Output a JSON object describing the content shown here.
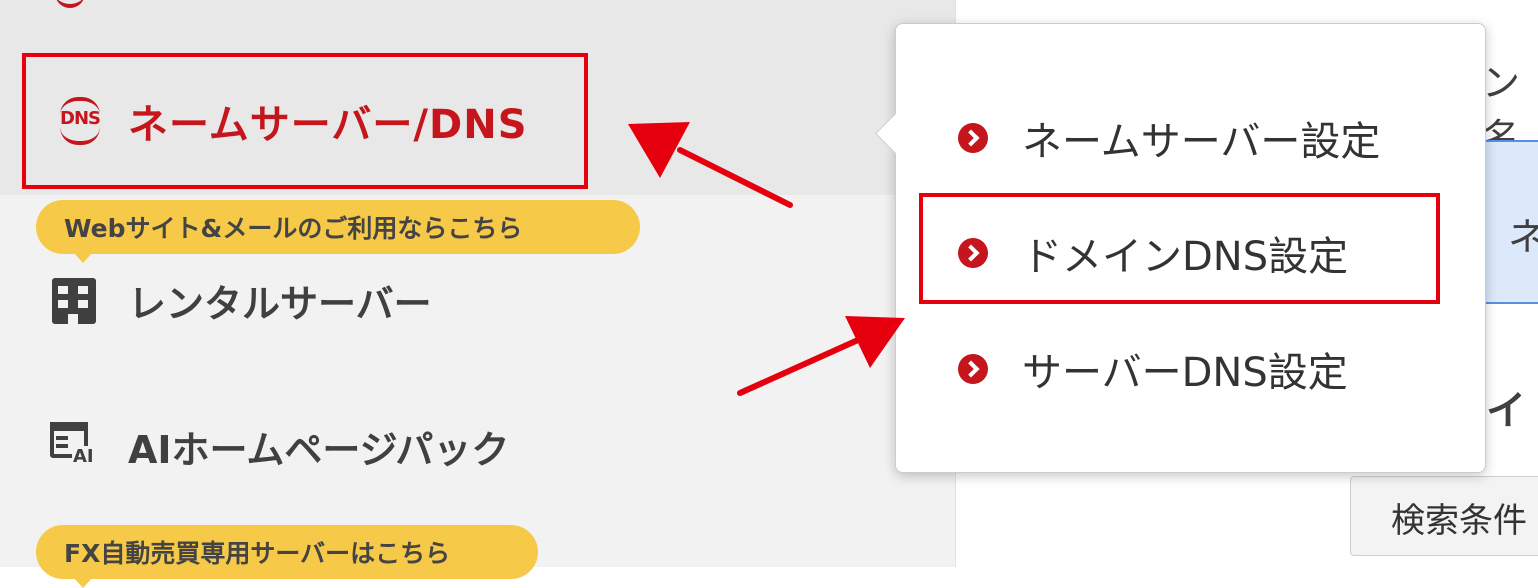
{
  "sidebar": {
    "active_item": {
      "icon": "dns-icon",
      "icon_text": "DNS",
      "label": "ネームサーバー/DNS"
    },
    "badge_web": "Webサイト&メールのご利用ならこちら",
    "rental": {
      "icon": "building-icon",
      "label": "レンタルサーバー"
    },
    "ai_pack": {
      "icon": "ai-homepage-icon",
      "icon_text": "AI",
      "label": "AIホームページパック"
    },
    "badge_fx": "FX自動売買専用サーバーはこちら"
  },
  "popup": {
    "items": [
      {
        "icon": "chevron-right-icon",
        "label": "ネームサーバー設定"
      },
      {
        "icon": "chevron-right-icon",
        "label": "ドメインDNS設定"
      },
      {
        "icon": "chevron-right-icon",
        "label": "サーバーDNS設定"
      }
    ]
  },
  "main": {
    "partial_1": "ン名",
    "partial_2": "ネ",
    "partial_3": "イ",
    "search_button_partial": "検索条件"
  },
  "colors": {
    "brand_red": "#c4161c",
    "highlight_red": "#e6000e",
    "badge_yellow": "#f7c948",
    "panel_blue": "#dbe9fb"
  }
}
